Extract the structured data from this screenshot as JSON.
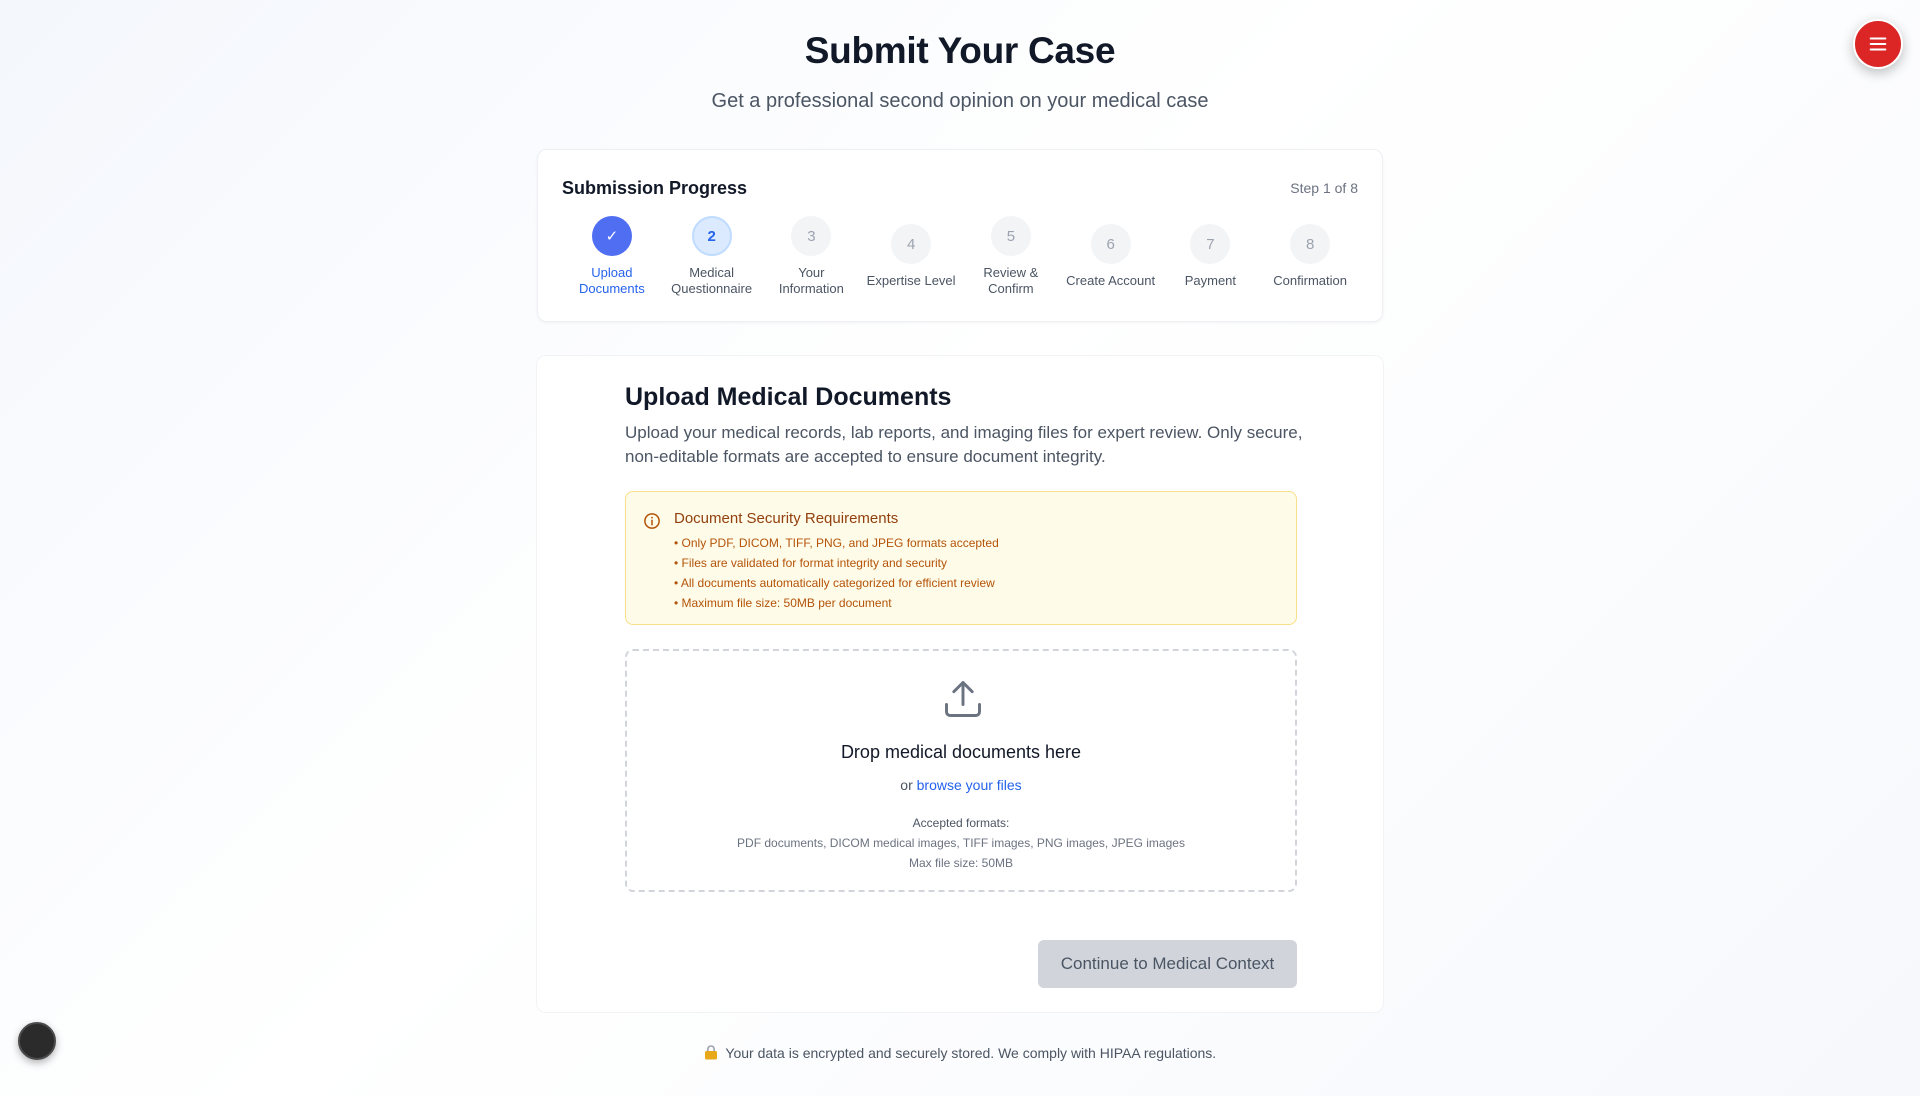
{
  "header": {
    "title": "Submit Your Case",
    "subtitle": "Get a professional second opinion on your medical case"
  },
  "menu": {
    "icon": "hamburger-menu-icon",
    "color": "#dc2626"
  },
  "progress": {
    "title": "Submission Progress",
    "step_indicator": "Step 1 of 8",
    "steps": [
      {
        "marker": "✓",
        "label_lines": [
          "Upload",
          "Documents"
        ],
        "state": "completed"
      },
      {
        "marker": "2",
        "label_lines": [
          "Medical",
          "Questionnaire"
        ],
        "state": "current"
      },
      {
        "marker": "3",
        "label_lines": [
          "Your",
          "Information"
        ],
        "state": "pending"
      },
      {
        "marker": "4",
        "label_lines": [
          "Expertise Level"
        ],
        "state": "pending"
      },
      {
        "marker": "5",
        "label_lines": [
          "Review &",
          "Confirm"
        ],
        "state": "pending"
      },
      {
        "marker": "6",
        "label_lines": [
          "Create Account"
        ],
        "state": "pending"
      },
      {
        "marker": "7",
        "label_lines": [
          "Payment"
        ],
        "state": "pending"
      },
      {
        "marker": "8",
        "label_lines": [
          "Confirmation"
        ],
        "state": "pending"
      }
    ]
  },
  "upload": {
    "title": "Upload Medical Documents",
    "description": "Upload your medical records, lab reports, and imaging files for expert review. Only secure, non-editable formats are accepted to ensure document integrity.",
    "security": {
      "icon": "info-icon",
      "title": "Document Security Requirements",
      "items": [
        "• Only PDF, DICOM, TIFF, PNG, and JPEG formats accepted",
        "• Files are validated for format integrity and security",
        "• All documents automatically categorized for efficient review",
        "• Maximum file size: 50MB per document"
      ]
    },
    "dropzone": {
      "icon": "upload-icon",
      "title": "Drop medical documents here",
      "or_text": "or",
      "browse_label": "browse your files",
      "formats_label": "Accepted formats:",
      "formats": "PDF documents, DICOM medical images, TIFF images, PNG images, JPEG images",
      "max_size": "Max file size: 50MB"
    },
    "continue_label": "Continue to Medical Context"
  },
  "footer": {
    "icon": "lock-icon",
    "text": "Your data is encrypted and securely stored. We comply with HIPAA regulations."
  },
  "colors": {
    "accent": "#4f6ef2",
    "link": "#2563eb",
    "warning_bg": "#fefbe8",
    "warning_text": "#b45309"
  }
}
